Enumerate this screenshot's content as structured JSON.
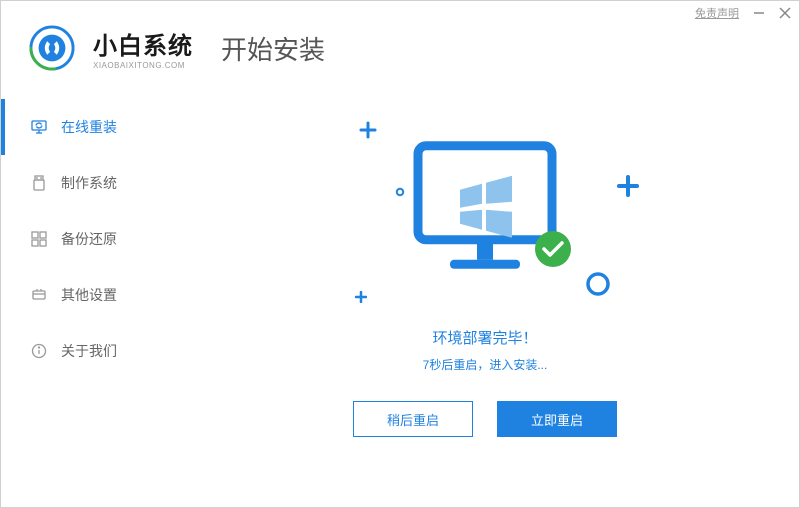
{
  "titlebar": {
    "disclaimer": "免责声明"
  },
  "brand": {
    "name": "小白系统",
    "url": "XIAOBAIXITONG.COM"
  },
  "page_title": "开始安装",
  "sidebar": {
    "items": [
      {
        "label": "在线重装",
        "icon": "monitor-refresh-icon",
        "active": true
      },
      {
        "label": "制作系统",
        "icon": "usb-icon",
        "active": false
      },
      {
        "label": "备份还原",
        "icon": "backup-icon",
        "active": false
      },
      {
        "label": "其他设置",
        "icon": "settings-icon",
        "active": false
      },
      {
        "label": "关于我们",
        "icon": "info-icon",
        "active": false
      }
    ]
  },
  "main": {
    "status_title": "环境部署完毕！",
    "status_sub": "7秒后重启，进入安装...",
    "btn_later": "稍后重启",
    "btn_now": "立即重启"
  },
  "colors": {
    "accent": "#1f82e0",
    "success": "#3cb04a"
  }
}
